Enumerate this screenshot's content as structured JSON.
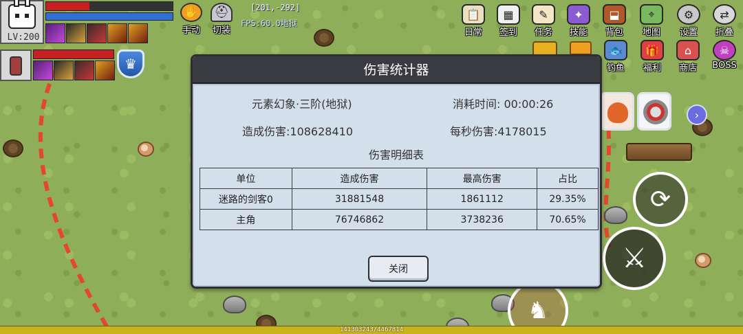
{
  "player": {
    "level_label": "LV:200",
    "hp_fraction": 0.34,
    "mp_fraction": 1.0
  },
  "toolbar_left": [
    {
      "label": "手动",
      "icon": "hand-icon",
      "color": "#f0a020"
    },
    {
      "label": "切装",
      "icon": "helmet-icon",
      "color": "#c8c8d0"
    }
  ],
  "status": {
    "coords": "[201,-292]",
    "fps": "FPS:60.0地狱"
  },
  "menu_row1": [
    {
      "label": "日常",
      "icon": "clipboard-icon",
      "color": "#e8e0c0"
    },
    {
      "label": "签到",
      "icon": "calendar-icon",
      "color": "#f0f0f0"
    },
    {
      "label": "任务",
      "icon": "scroll-icon",
      "color": "#f5e6c8"
    },
    {
      "label": "技能",
      "icon": "book-icon",
      "color": "#8a5cd0"
    },
    {
      "label": "背包",
      "icon": "bag-icon",
      "color": "#b0582a"
    },
    {
      "label": "地图",
      "icon": "map-icon",
      "color": "#7ab860"
    },
    {
      "label": "设置",
      "icon": "gear-icon",
      "color": "#c8c8c8"
    },
    {
      "label": "折叠",
      "icon": "collapse-icon",
      "color": "#d8d8d8"
    }
  ],
  "menu_row2": [
    {
      "label": "钓鱼",
      "icon": "fish-icon",
      "color": "#5a8ad0"
    },
    {
      "label": "福利",
      "icon": "gift-icon",
      "color": "#e04040"
    },
    {
      "label": "商店",
      "icon": "shop-icon",
      "color": "#d85050"
    },
    {
      "label": "BOSS",
      "icon": "boss-icon",
      "color": "#c040c0"
    }
  ],
  "exp_text": "141303243/4467814",
  "dialog": {
    "title": "伤害统计器",
    "dungeon": "元素幻象·三阶(地狱)",
    "time_label": "消耗时间: 00:00:26",
    "damage_label": "造成伤害:108628410",
    "dps_label": "每秒伤害:4178015",
    "subtitle": "伤害明细表",
    "columns": [
      "单位",
      "造成伤害",
      "最高伤害",
      "占比"
    ],
    "rows": [
      [
        "迷路的剑客0",
        "31881548",
        "1861112",
        "29.35%"
      ],
      [
        "主角",
        "76746862",
        "3738236",
        "70.65%"
      ]
    ],
    "close_label": "关闭"
  }
}
